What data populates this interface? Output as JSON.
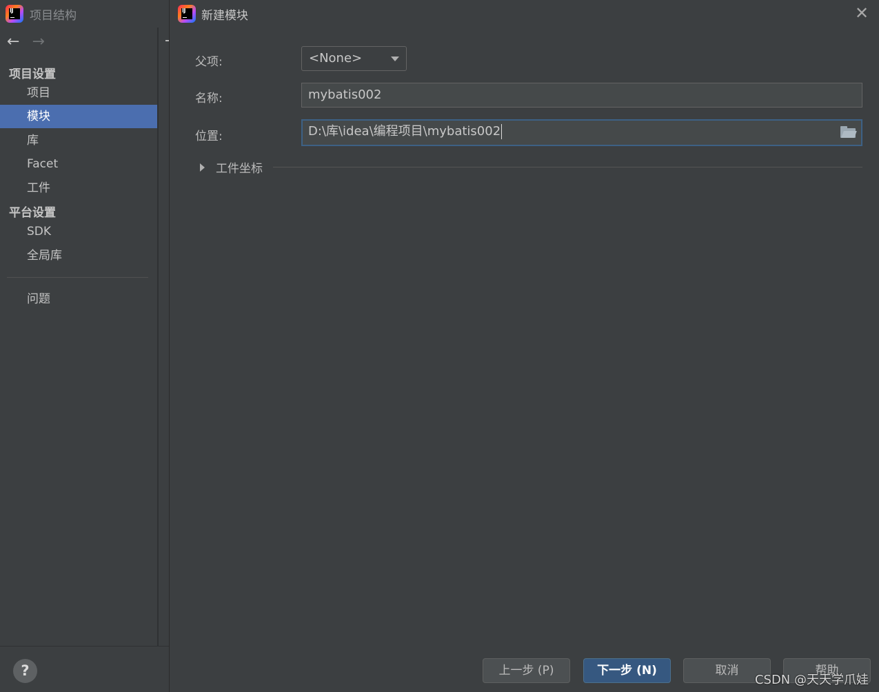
{
  "background_window": {
    "title": "项目结构",
    "nav": {
      "back": "←",
      "forward": "→"
    },
    "sections": [
      {
        "header": "项目设置",
        "items": [
          "项目",
          "模块",
          "库",
          "Facet",
          "工件"
        ]
      },
      {
        "header": "平台设置",
        "items": [
          "SDK",
          "全局库"
        ]
      }
    ],
    "selected_item": "模块",
    "problems_label": "问题",
    "help_label": "?"
  },
  "dialog": {
    "title": "新建模块",
    "close": "✕",
    "fields": {
      "parent": {
        "label": "父项:",
        "value": "<None>"
      },
      "name": {
        "label": "名称:",
        "value": "mybatis002"
      },
      "location": {
        "label": "位置:",
        "value": "D:\\库\\idea\\编程项目\\mybatis002"
      }
    },
    "artifact_coords_label": "工件坐标",
    "buttons": {
      "previous": "上一步 (P)",
      "next": "下一步 (N)",
      "cancel": "取消",
      "help": "帮助"
    }
  },
  "watermark": "CSDN @天天学爪娃",
  "colors": {
    "background": "#3c3f41",
    "selection": "#4b6eaf",
    "primary_button": "#365880",
    "focus_border": "#3d6185"
  }
}
